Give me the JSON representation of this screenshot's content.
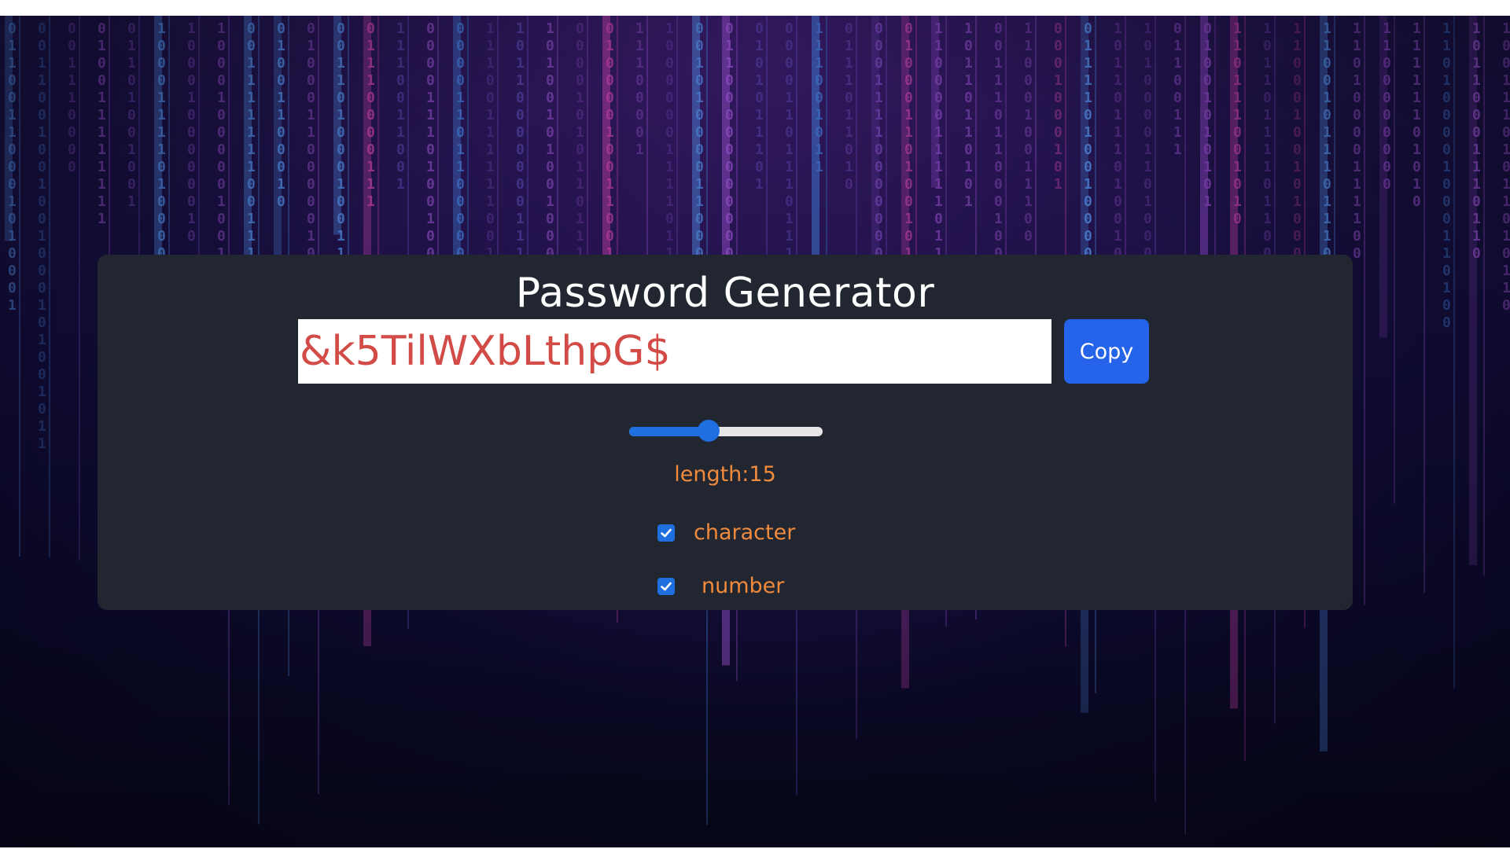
{
  "app": {
    "title": "Password Generator"
  },
  "password": {
    "value": "&k5TilWXbLthpG$"
  },
  "copy_button": {
    "label": "Copy"
  },
  "length_slider": {
    "level_fraction": 0.41
  },
  "length_label": "length:15",
  "options": [
    {
      "label": "character",
      "checked": true
    },
    {
      "label": "number",
      "checked": true
    }
  ],
  "colors": {
    "panel_bg": "#212631",
    "accent_blue": "#2563eb",
    "password_text": "#d24b46",
    "label_orange": "#f08a3c"
  },
  "background": {
    "description_icon": "binary-code-matrix-background"
  }
}
